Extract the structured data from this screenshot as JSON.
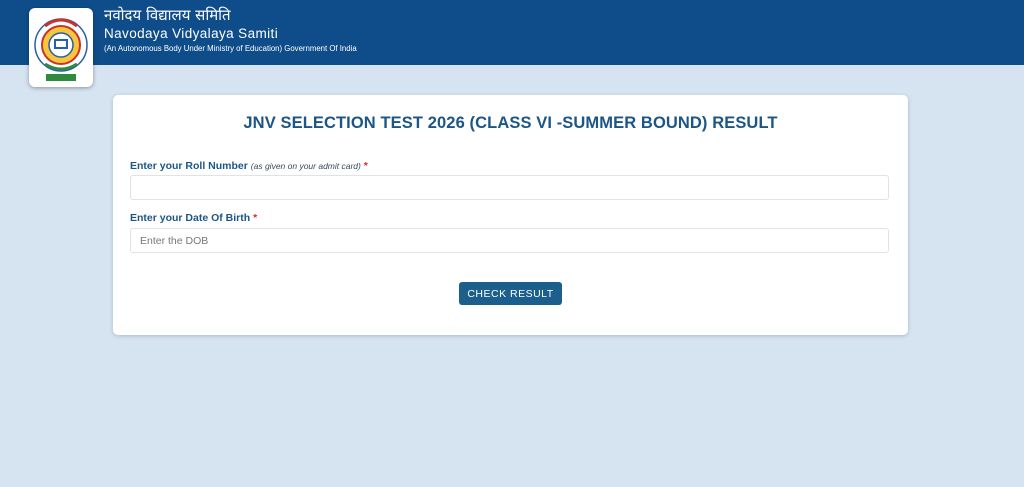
{
  "header": {
    "hindi_title": "नवोदय विद्यालय समिति",
    "english_title": "Navodaya Vidyalaya Samiti",
    "subtitle": "(An Autonomous Body Under Ministry of Education) Government Of India",
    "logo_icon": "nvs-emblem-icon",
    "background_color": "#0f4d8a"
  },
  "form": {
    "title": "JNV SELECTION TEST 2026 (CLASS VI -SUMMER BOUND) RESULT",
    "roll_number": {
      "label": "Enter your Roll Number",
      "hint": "(as given on your admit card)",
      "required_mark": "*",
      "value": "",
      "placeholder": ""
    },
    "dob": {
      "label": "Enter your Date Of Birth",
      "required_mark": "*",
      "value": "",
      "placeholder": "Enter the DOB"
    },
    "submit_label": "CHECK RESULT"
  },
  "colors": {
    "accent": "#1c5686",
    "button": "#1c5f8c",
    "page_background": "#d6e3f1",
    "required": "#d32f2f"
  }
}
